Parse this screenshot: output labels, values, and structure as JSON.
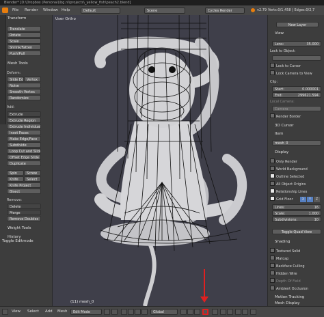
{
  "window": {
    "title": "Blender* [D:\\Dropbox (Personal)\\bg.nl\\projects\\_yellow_fish\\peach2.blend]"
  },
  "infobar": {
    "menus": [
      "File",
      "Render",
      "Window",
      "Help"
    ],
    "screen_layout": "Default",
    "scene": "Scene",
    "render_engine": "Cycles Render",
    "version": "v2.79",
    "stats": "Verts:0/1,458 | Edges:0/2,7"
  },
  "toolshelf": {
    "transform": {
      "title": "Transform",
      "buttons": [
        "Translate",
        "Rotate",
        "Scale",
        "Shrink/Fatten",
        "Push/Pull"
      ]
    },
    "mesh_tools": {
      "title": "Mesh Tools",
      "deform_label": "Deform:",
      "deform_row": [
        "Slide Ed",
        "Vertex"
      ],
      "deform_buttons": [
        "Noise",
        "Smooth Vertex",
        "Randomize"
      ],
      "add_label": "Add:",
      "add_buttons": [
        "Extrude",
        "Extrude Region",
        "Extrude Individual",
        "Inset Faces",
        "Make Edge/Face",
        "Subdivide",
        "Loop Cut and Slide",
        "Offset Edge Slide",
        "Duplicate"
      ],
      "add_row1": [
        "Spin",
        "Screw"
      ],
      "add_row2": [
        "Knife",
        "Select"
      ],
      "add_buttons2": [
        "Knife Project",
        "Bisect"
      ],
      "remove_label": "Remove:",
      "remove_buttons": [
        "Delete",
        "Merge",
        "Remove Doubles"
      ]
    },
    "weight_tools": "Weight Tools",
    "history": "History",
    "operator": "Toggle Editmode"
  },
  "viewport": {
    "label": "User Ortho",
    "object_info": "(11) mesh_0"
  },
  "npanel": {
    "new_layer": "New Layer",
    "view": {
      "title": "View",
      "lens_label": "Lens:",
      "lens_value": "35.000",
      "lock_to_object": "Lock to Object:",
      "lock_to_cursor": "Lock to Cursor",
      "lock_camera": "Lock Camera to View",
      "clip": "Clip:",
      "start_label": "Start:",
      "start_value": "0.000001",
      "end_label": "End:",
      "end_value": "299621.594",
      "local_camera": "Local Camera:",
      "camera": "Camera",
      "render_border": "Render Border"
    },
    "cursor_3d": "3D Cursor",
    "item": {
      "title": "Item",
      "name": "mesh_0"
    },
    "display": {
      "title": "Display",
      "only_render": "Only Render",
      "world_background": "World Background",
      "outline_selected": "Outline Selected",
      "all_object_origins": "All Object Origins",
      "relationship_lines": "Relationship Lines",
      "grid_floor": "Grid Floor",
      "axes": [
        "X",
        "Y",
        "Z"
      ],
      "lines_label": "Lines:",
      "lines_value": "16",
      "scale_label": "Scale:",
      "scale_value": "1.000",
      "subdivisions_label": "Subdivisions:",
      "subdivisions_value": "10",
      "toggle_quad": "Toggle Quad View"
    },
    "shading": {
      "title": "Shading",
      "textured_solid": "Textured Solid",
      "matcap": "Matcap",
      "backface_culling": "Backface Culling",
      "hidden_wire": "Hidden Wire",
      "depth_of_field": "Depth Of Field",
      "ambient_occlusion": "Ambient Occlusion"
    },
    "motion_tracking": "Motion Tracking",
    "mesh_display": "Mesh Display"
  },
  "bottombar": {
    "menus": [
      "View",
      "Select",
      "Add",
      "Mesh"
    ],
    "mode": "Edit Mode",
    "pivot": "Global"
  },
  "colors": {
    "annotation": "#e02020",
    "viewport_bg": "#3f3f4a"
  }
}
